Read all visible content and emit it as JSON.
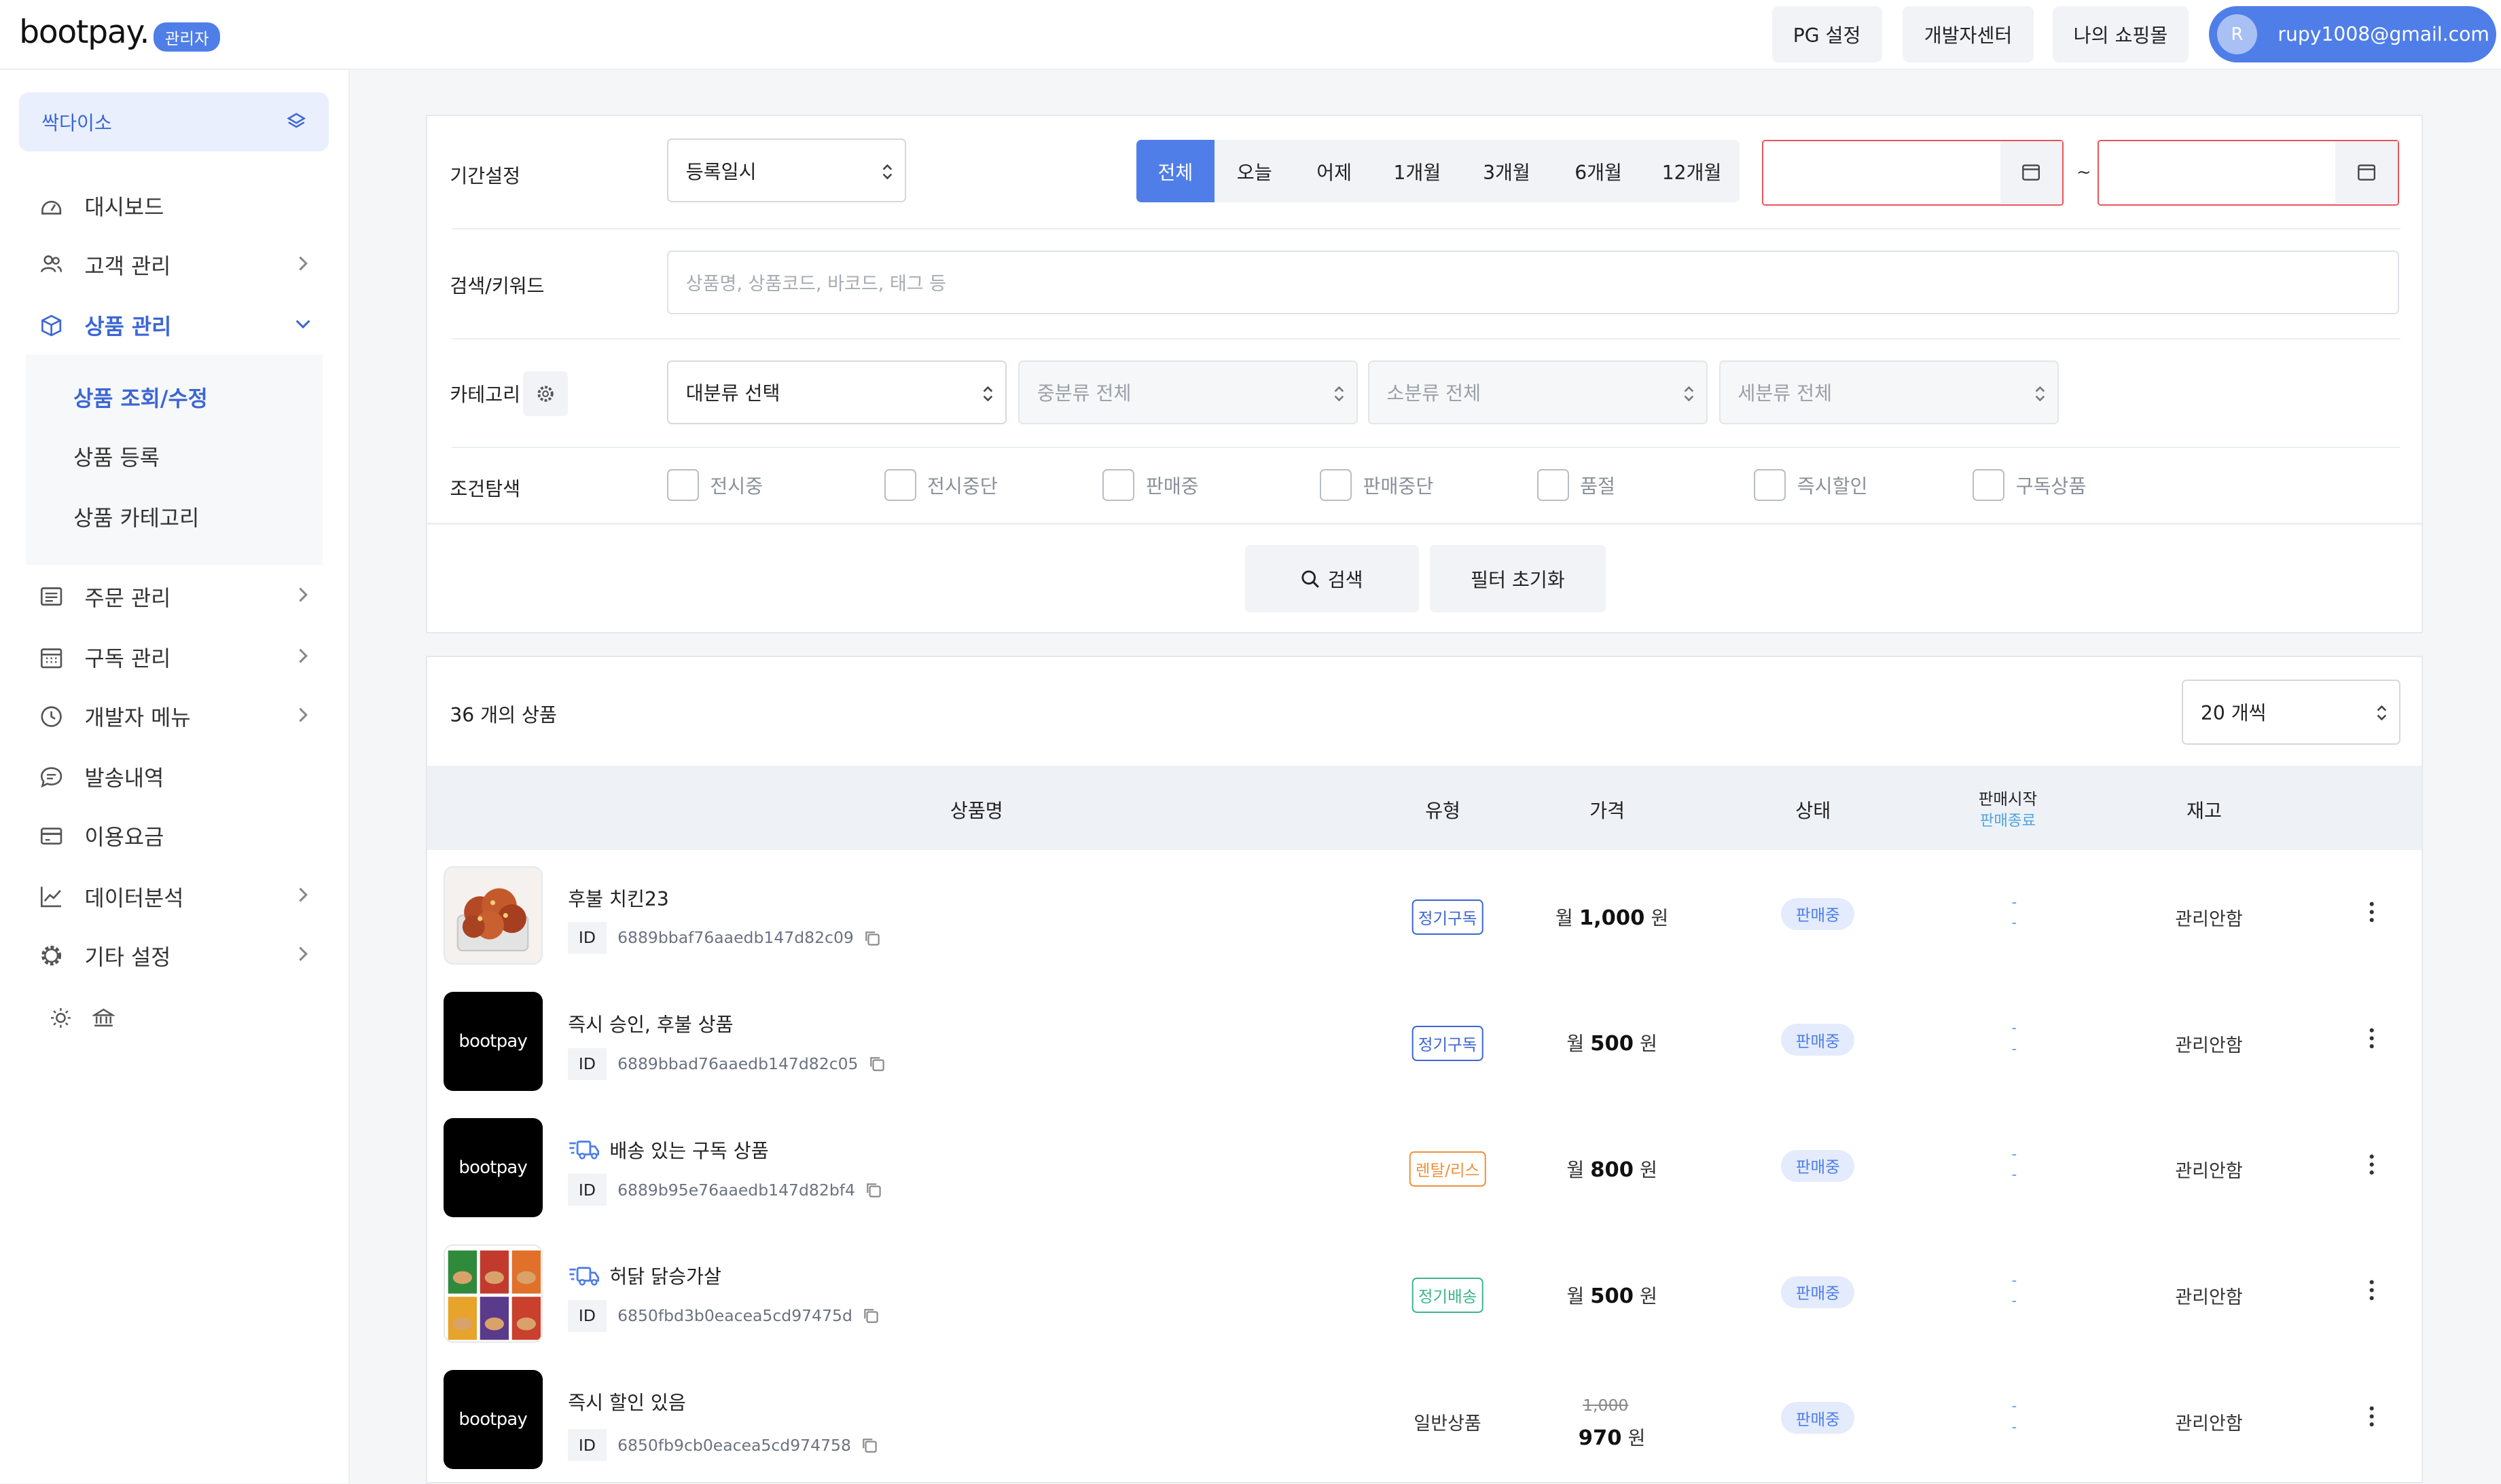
{
  "header": {
    "logo": "bootpay.",
    "admin_badge": "관리자",
    "pg_settings": "PG 설정",
    "dev_center": "개발자센터",
    "my_shop": "나의 쇼핑몰",
    "user_initial": "R",
    "user_email": "rupy1008@gmail.com"
  },
  "sidebar": {
    "store_name": "싹다이소",
    "items": [
      {
        "label": "대시보드"
      },
      {
        "label": "고객 관리"
      },
      {
        "label": "상품 관리"
      },
      {
        "label": "주문 관리"
      },
      {
        "label": "구독 관리"
      },
      {
        "label": "개발자 메뉴"
      },
      {
        "label": "발송내역"
      },
      {
        "label": "이용요금"
      },
      {
        "label": "데이터분석"
      },
      {
        "label": "기타 설정"
      }
    ],
    "subitems": [
      {
        "label": "상품 조회/수정"
      },
      {
        "label": "상품 등록"
      },
      {
        "label": "상품 카테고리"
      }
    ]
  },
  "filter": {
    "period_label": "기간설정",
    "date_type": "등록일시",
    "periods": [
      "전체",
      "오늘",
      "어제",
      "1개월",
      "3개월",
      "6개월",
      "12개월"
    ],
    "active_period": "전체",
    "tilde": "~",
    "keyword_label": "검색/키워드",
    "keyword_placeholder": "상품명, 상품코드, 바코드, 태그 등",
    "category_label": "카테고리",
    "cat_large": "대분류 선택",
    "cat_medium": "중분류 전체",
    "cat_small": "소분류 전체",
    "cat_detail": "세분류 전체",
    "condition_label": "조건탐색",
    "conditions": [
      "전시중",
      "전시중단",
      "판매중",
      "판매중단",
      "품절",
      "즉시할인",
      "구독상품"
    ],
    "search_btn": "검색",
    "reset_btn": "필터 초기화"
  },
  "list": {
    "count_text": "36 개의 상품",
    "per_page": "20 개씩",
    "columns": {
      "name": "상품명",
      "type": "유형",
      "price": "가격",
      "status": "상태",
      "sale_start": "판매시작",
      "sale_end": "판매종료",
      "stock": "재고"
    },
    "rows": [
      {
        "name": "후불 치킨23",
        "id_label": "ID",
        "id": "6889bbaf76aaedb147d82c09",
        "type": "정기구독",
        "price_prefix": "월",
        "price": "1,000",
        "unit": "원",
        "status": "판매중",
        "start": "-",
        "end": "-",
        "stock": "관리안함"
      },
      {
        "name": "즉시 승인, 후불 상품",
        "id_label": "ID",
        "id": "6889bbad76aaedb147d82c05",
        "type": "정기구독",
        "price_prefix": "월",
        "price": "500",
        "unit": "원",
        "status": "판매중",
        "start": "-",
        "end": "-",
        "stock": "관리안함",
        "thumb_text": "bootpay"
      },
      {
        "name": "배송 있는 구독 상품",
        "id_label": "ID",
        "id": "6889b95e76aaedb147d82bf4",
        "type": "렌탈/리스",
        "price_prefix": "월",
        "price": "800",
        "unit": "원",
        "status": "판매중",
        "start": "-",
        "end": "-",
        "stock": "관리안함",
        "thumb_text": "bootpay"
      },
      {
        "name": "허닭 닭승가살",
        "id_label": "ID",
        "id": "6850fbd3b0eacea5cd97475d",
        "type": "정기배송",
        "price_prefix": "월",
        "price": "500",
        "unit": "원",
        "status": "판매중",
        "start": "-",
        "end": "-",
        "stock": "관리안함"
      },
      {
        "name": "즉시 할인 있음",
        "id_label": "ID",
        "id": "6850fb9cb0eacea5cd974758",
        "type": "일반상품",
        "original_price": "1,000",
        "price": "970",
        "unit": "원",
        "status": "판매중",
        "start": "-",
        "end": "-",
        "stock": "관리안함",
        "thumb_text": "bootpay"
      }
    ]
  },
  "colors": {
    "accent": "#4f7ee8",
    "type_subscription": "#3b66d6",
    "type_rental": "#f0903a",
    "type_delivery": "#3bb58a",
    "date_error": "#e8545b"
  }
}
